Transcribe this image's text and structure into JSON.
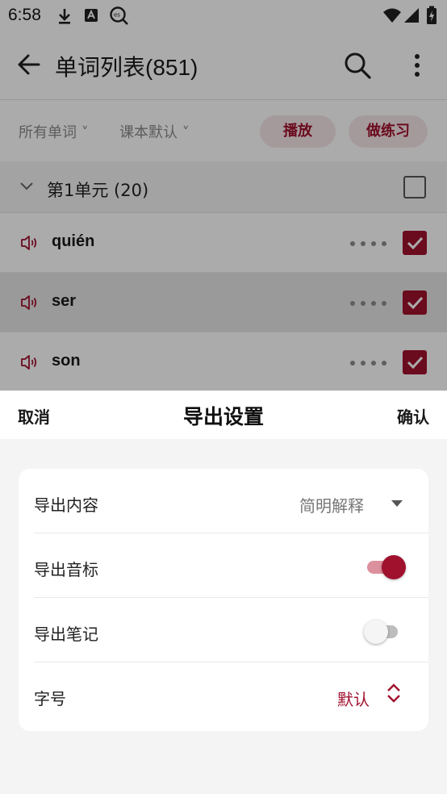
{
  "status_bar": {
    "time": "6:58",
    "left_icons": [
      "download-icon",
      "a-badge-icon",
      "es-search-icon"
    ],
    "right_icons": [
      "wifi-icon",
      "signal-icon",
      "battery-charging-icon"
    ]
  },
  "app_bar": {
    "title": "单词列表(851)"
  },
  "filters": {
    "scope": "所有单词 ˅",
    "order": "课本默认 ˅",
    "play": "播放",
    "practice": "做练习"
  },
  "unit": {
    "title": "第1单元 (20)",
    "checked": false
  },
  "words": [
    {
      "text": "quién",
      "checked": true
    },
    {
      "text": "ser",
      "checked": true
    },
    {
      "text": "son",
      "checked": true
    }
  ],
  "sheet": {
    "cancel": "取消",
    "title": "导出设置",
    "confirm": "确认",
    "rows": [
      {
        "label": "导出内容",
        "value": "简明解释",
        "control": "dropdown"
      },
      {
        "label": "导出音标",
        "control": "switch",
        "on": true
      },
      {
        "label": "导出笔记",
        "control": "switch",
        "on": false
      },
      {
        "label": "字号",
        "value": "默认",
        "control": "stepper"
      }
    ]
  },
  "colors": {
    "accent": "#a0112e",
    "accent_light": "#f6e6e8"
  }
}
